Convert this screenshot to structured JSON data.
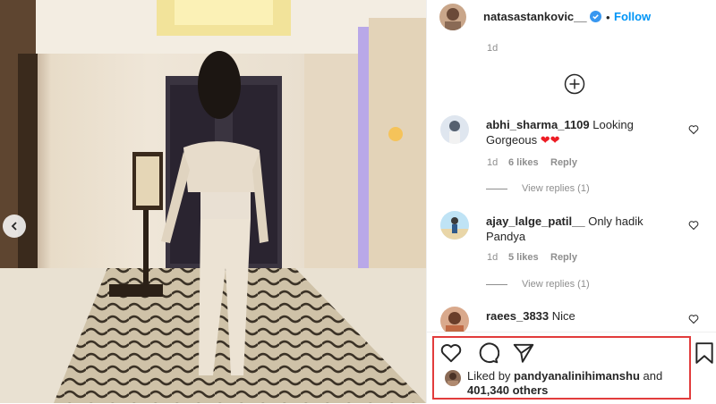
{
  "post": {
    "author": "natasastankovic__",
    "separator": "•",
    "follow_label": "Follow",
    "top_time": "1d"
  },
  "comments": [
    {
      "user": "abhi_sharma_1109",
      "text": "Looking Gorgeous ❤❤",
      "time": "1d",
      "likes": "6 likes",
      "reply_label": "Reply",
      "view_replies": "View replies (1)"
    },
    {
      "user": "ajay_lalge_patil__",
      "text": "Only hadik Pandya",
      "time": "1d",
      "likes": "5 likes",
      "reply_label": "Reply",
      "view_replies": "View replies (1)"
    },
    {
      "user": "raees_3833",
      "text": "Nice"
    }
  ],
  "likes": {
    "prefix": "Liked by",
    "liker": "pandyanalinihimanshu",
    "conjunction": "and",
    "others": "401,340 others"
  },
  "colors": {
    "accent": "#0095f6",
    "verified": "#3897f0",
    "highlight": "#e23c3c",
    "heart": "#ed1c24"
  },
  "icons": [
    "chevron-left-icon",
    "verified-badge-icon",
    "add-circle-icon",
    "heart-outline-icon",
    "comment-icon",
    "share-icon",
    "bookmark-icon"
  ]
}
